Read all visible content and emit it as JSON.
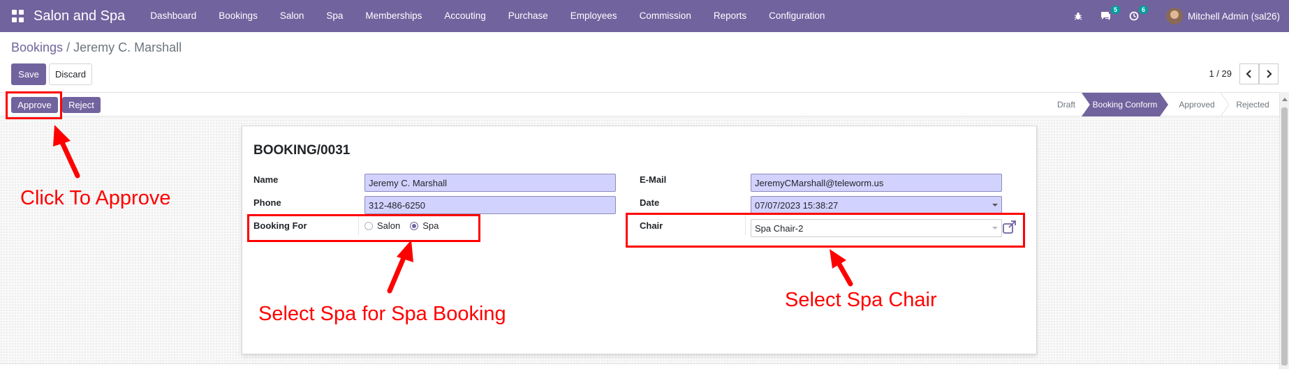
{
  "navbar": {
    "brand": "Salon and Spa",
    "menu": [
      "Dashboard",
      "Bookings",
      "Salon",
      "Spa",
      "Memberships",
      "Accouting",
      "Purchase",
      "Employees",
      "Commission",
      "Reports",
      "Configuration"
    ],
    "messages_count": "5",
    "activities_count": "6",
    "user": "Mitchell Admin (sal26)"
  },
  "breadcrumb": {
    "parent": "Bookings",
    "separator": "/",
    "current": "Jeremy C. Marshall"
  },
  "actions": {
    "save": "Save",
    "discard": "Discard",
    "approve": "Approve",
    "reject": "Reject"
  },
  "pager": {
    "value": "1 / 29"
  },
  "statusbar": {
    "stages": [
      "Draft",
      "Booking Conform",
      "Approved",
      "Rejected"
    ],
    "active": "Booking Conform"
  },
  "form": {
    "title": "BOOKING/0031",
    "name_label": "Name",
    "name_value": "Jeremy C. Marshall",
    "phone_label": "Phone",
    "phone_value": "312-486-6250",
    "booking_for_label": "Booking For",
    "booking_for_options": [
      "Salon",
      "Spa"
    ],
    "booking_for_selected": "Spa",
    "email_label": "E-Mail",
    "email_value": "JeremyCMarshall@teleworm.us",
    "date_label": "Date",
    "date_value": "07/07/2023 15:38:27",
    "chair_label": "Chair",
    "chair_value": "Spa Chair-2"
  },
  "annotations": {
    "approve": "Click To Approve",
    "spa": "Select Spa for Spa Booking",
    "chair": "Select Spa Chair"
  },
  "colors": {
    "brand": "#71639e",
    "annotation": "#ff0000",
    "required_field": "#d2d2ff"
  }
}
